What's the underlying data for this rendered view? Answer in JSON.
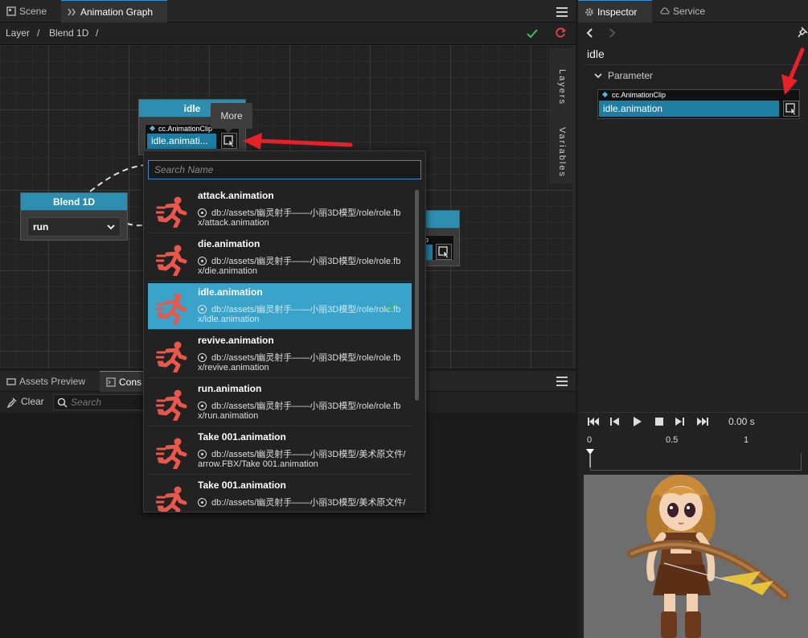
{
  "left_tabs": [
    {
      "label": "Scene",
      "icon": "scene-icon"
    },
    {
      "label": "Animation Graph",
      "icon": "animation-graph-icon"
    }
  ],
  "breadcrumb": {
    "parts": [
      "Layer",
      "/",
      "Blend 1D",
      "/"
    ]
  },
  "side_tabs": {
    "layers": "Layers",
    "variables": "Variables"
  },
  "nodes": {
    "idle": {
      "title": "idle",
      "clip_type": "cc.AnimationClip",
      "clip_value": "idle.animati..."
    },
    "blend": {
      "title": "Blend 1D",
      "select_value": "run"
    },
    "partial": {
      "clip_type": "p"
    }
  },
  "tooltip": "More",
  "popup": {
    "search_placeholder": "Search Name",
    "items": [
      {
        "name": "attack.animation",
        "path1": "db://assets/幽灵射手——小丽3D模型/role/role.fb",
        "path2": "x/attack.animation",
        "selected": false
      },
      {
        "name": "die.animation",
        "path1": "db://assets/幽灵射手——小丽3D模型/role/role.fb",
        "path2": "x/die.animation",
        "selected": false
      },
      {
        "name": "idle.animation",
        "path1": "db://assets/幽灵射手——小丽3D模型/role/role.fb",
        "path2": "x/idle.animation",
        "selected": true
      },
      {
        "name": "revive.animation",
        "path1": "db://assets/幽灵射手——小丽3D模型/role/role.fb",
        "path2": "x/revive.animation",
        "selected": false
      },
      {
        "name": "run.animation",
        "path1": "db://assets/幽灵射手——小丽3D模型/role/role.fb",
        "path2": "x/run.animation",
        "selected": false
      },
      {
        "name": "Take 001.animation",
        "path1": "db://assets/幽灵射手——小丽3D模型/美术原文件/",
        "path2": "arrow.FBX/Take 001.animation",
        "selected": false
      },
      {
        "name": "Take 001.animation",
        "path1": "db://assets/幽灵射手——小丽3D模型/美术原文件/",
        "path2": "",
        "selected": false
      }
    ]
  },
  "bottom_tabs": [
    {
      "label": "Assets Preview",
      "icon": "assets-preview-icon"
    },
    {
      "label": "Cons",
      "icon": "console-icon"
    }
  ],
  "console_toolbar": {
    "clear_label": "Clear",
    "search_placeholder": "Search"
  },
  "inspector": {
    "tabs": [
      {
        "label": "Inspector",
        "icon": "gear-icon"
      },
      {
        "label": "Service",
        "icon": "cloud-icon"
      }
    ],
    "node_name": "idle",
    "section": "Parameter",
    "clip_type": "cc.AnimationClip",
    "clip_value": "idle.animation",
    "time": "0.00 s",
    "ruler_labels": [
      "0",
      "0.5",
      "1"
    ]
  },
  "colors": {
    "accent": "#2d8eb0",
    "selection": "#3aa3c9",
    "clip_field": "#1e7da0",
    "arrow": "#e8202a",
    "runner": "#e8574a",
    "ok": "#3cc25a",
    "refresh": "#e0404a"
  }
}
